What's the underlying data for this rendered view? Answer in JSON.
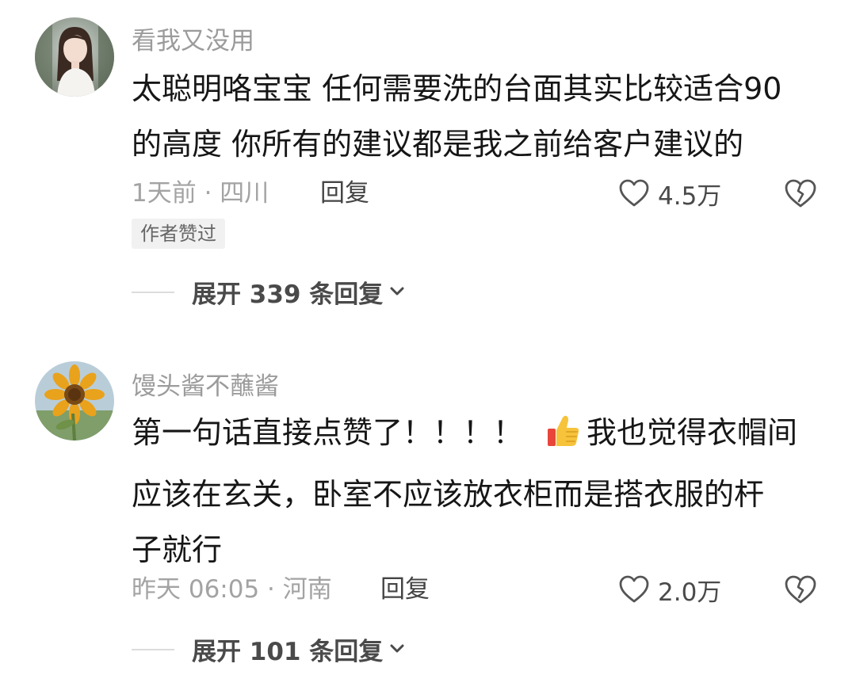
{
  "comments": [
    {
      "username": "看我又没用",
      "avatar_icon": "girl-portrait-avatar",
      "content_lines": [
        "太聪明咯宝宝 任何需要洗的台面其实比较适合90",
        "的高度 你所有的建议都是我之前给客户建议的"
      ],
      "meta": "1天前 · 四川",
      "reply_label": "回复",
      "likes": "4.5万",
      "author_badge": "作者赞过",
      "expand_label": "展开 339 条回复"
    },
    {
      "username": "馒头酱不蘸酱",
      "avatar_icon": "sunflower-avatar",
      "content_lines": [
        "第一句话直接点赞了！！！！",
        "我也觉得衣帽间",
        "应该在玄关，卧室不应该放衣柜而是搭衣服的杆",
        "子就行"
      ],
      "emoji": "thumbs-up-emoji",
      "meta": "昨天 06:05 · 河南",
      "reply_label": "回复",
      "likes": "2.0万",
      "expand_label": "展开 101 条回复"
    }
  ],
  "icons": {
    "like": "heart-outline-icon",
    "dislike": "broken-heart-icon",
    "expand": "chevron-down-icon"
  },
  "colors": {
    "username": "#9b9b9b",
    "meta": "#a3a3a3",
    "text": "#161616",
    "badge_bg": "#f1f1f1"
  }
}
